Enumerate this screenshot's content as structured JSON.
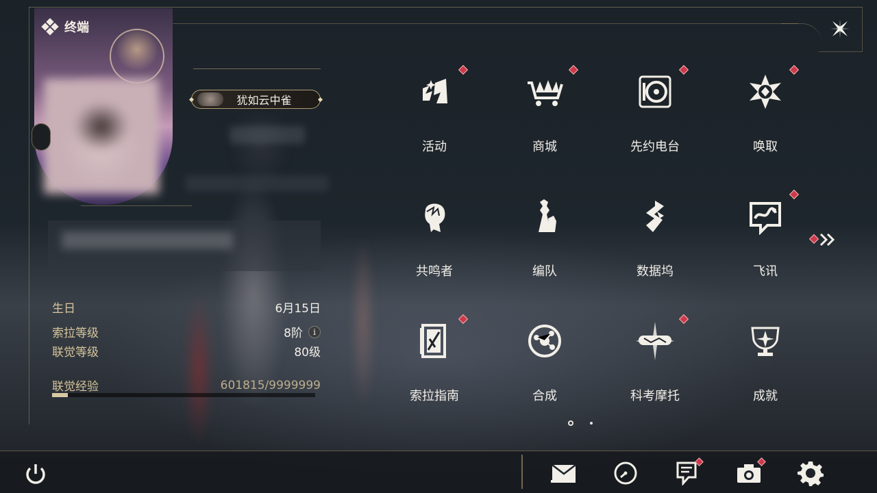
{
  "header": {
    "title": "终端"
  },
  "profile": {
    "title_badge": "犹如云中雀",
    "stats": [
      {
        "label": "生日",
        "value": "6月15日"
      },
      {
        "label": "索拉等级",
        "value": "8阶"
      },
      {
        "label": "联觉等级",
        "value": "80级"
      },
      {
        "label": "联觉经验",
        "value": "601815/9999999"
      }
    ],
    "exp_progress": 0.06,
    "info_glyph": "i"
  },
  "menu": {
    "items": [
      {
        "label": "活动",
        "icon": "activity-icon",
        "badge": true
      },
      {
        "label": "商城",
        "icon": "shop-cart-icon",
        "badge": true
      },
      {
        "label": "先约电台",
        "icon": "radio-icon",
        "badge": true
      },
      {
        "label": "唤取",
        "icon": "convene-icon",
        "badge": true
      },
      {
        "label": "共鸣者",
        "icon": "resonator-icon",
        "badge": false
      },
      {
        "label": "编队",
        "icon": "team-icon",
        "badge": false
      },
      {
        "label": "数据坞",
        "icon": "data-bank-icon",
        "badge": false
      },
      {
        "label": "飞讯",
        "icon": "message-icon",
        "badge": true
      },
      {
        "label": "索拉指南",
        "icon": "guide-book-icon",
        "badge": true
      },
      {
        "label": "合成",
        "icon": "synthesis-icon",
        "badge": false
      },
      {
        "label": "科考摩托",
        "icon": "motorbike-icon",
        "badge": true
      },
      {
        "label": "成就",
        "icon": "trophy-icon",
        "badge": false
      }
    ],
    "page": 1,
    "page_count": 2
  },
  "bottom": {
    "buttons": [
      {
        "name": "mail",
        "icon": "mail-icon",
        "badge": false
      },
      {
        "name": "clock",
        "icon": "clock-icon",
        "badge": false
      },
      {
        "name": "notice",
        "icon": "notice-icon",
        "badge": true
      },
      {
        "name": "camera",
        "icon": "camera-icon",
        "badge": true
      },
      {
        "name": "settings",
        "icon": "gear-icon",
        "badge": false
      }
    ]
  },
  "colors": {
    "accent_gold": "#d6c59c",
    "badge_red": "#cc3a4a",
    "text": "#f1eee8"
  }
}
